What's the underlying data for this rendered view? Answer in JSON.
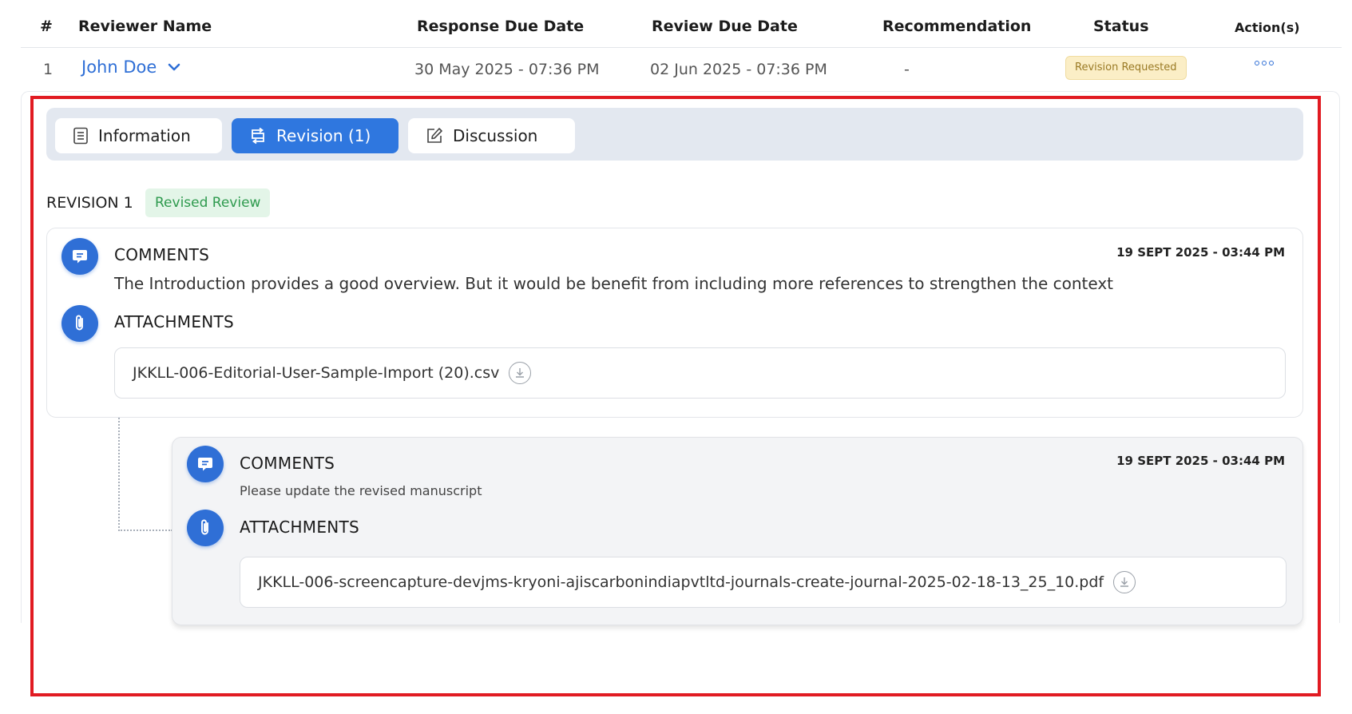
{
  "table": {
    "headers": {
      "number": "#",
      "reviewer_name": "Reviewer Name",
      "response_due": "Response Due Date",
      "review_due": "Review Due Date",
      "recommendation": "Recommendation",
      "status": "Status",
      "actions": "Action(s)"
    },
    "row": {
      "number": "1",
      "reviewer_name": "John Doe",
      "response_due": "30 May 2025 - 07:36 PM",
      "review_due": "02 Jun 2025 - 07:36 PM",
      "recommendation": "-",
      "status": "Revision Requested"
    }
  },
  "tabs": [
    {
      "label": "Information",
      "icon": "document-icon",
      "active": false
    },
    {
      "label": "Revision (1)",
      "icon": "revision-icon",
      "active": true
    },
    {
      "label": "Discussion",
      "icon": "edit-icon",
      "active": false
    }
  ],
  "revision": {
    "title": "REVISION 1",
    "badge": "Revised Review",
    "comment": {
      "label": "COMMENTS",
      "timestamp": "19 SEPT 2025 - 03:44 PM",
      "text": "The Introduction provides a good overview. But it would be benefit from including more references to strengthen the context",
      "attachments_label": "ATTACHMENTS",
      "attachment": "JKKLL-006-Editorial-User-Sample-Import (20).csv"
    },
    "reply": {
      "label": "COMMENTS",
      "timestamp": "19 SEPT 2025 - 03:44 PM",
      "text": "Please update the revised manuscript",
      "attachments_label": "ATTACHMENTS",
      "attachment": "JKKLL-006-screencapture-devjms-kryoni-ajiscarbonindiapvtltd-journals-create-journal-2025-02-18-13_25_10.pdf"
    }
  },
  "colors": {
    "accent": "#2f6fd6",
    "active_tab": "#2f77df",
    "highlight": "#e11b22",
    "status_bg": "#fbeec6",
    "badge_bg": "#e3f5e8",
    "badge_text": "#2e9a4e"
  }
}
